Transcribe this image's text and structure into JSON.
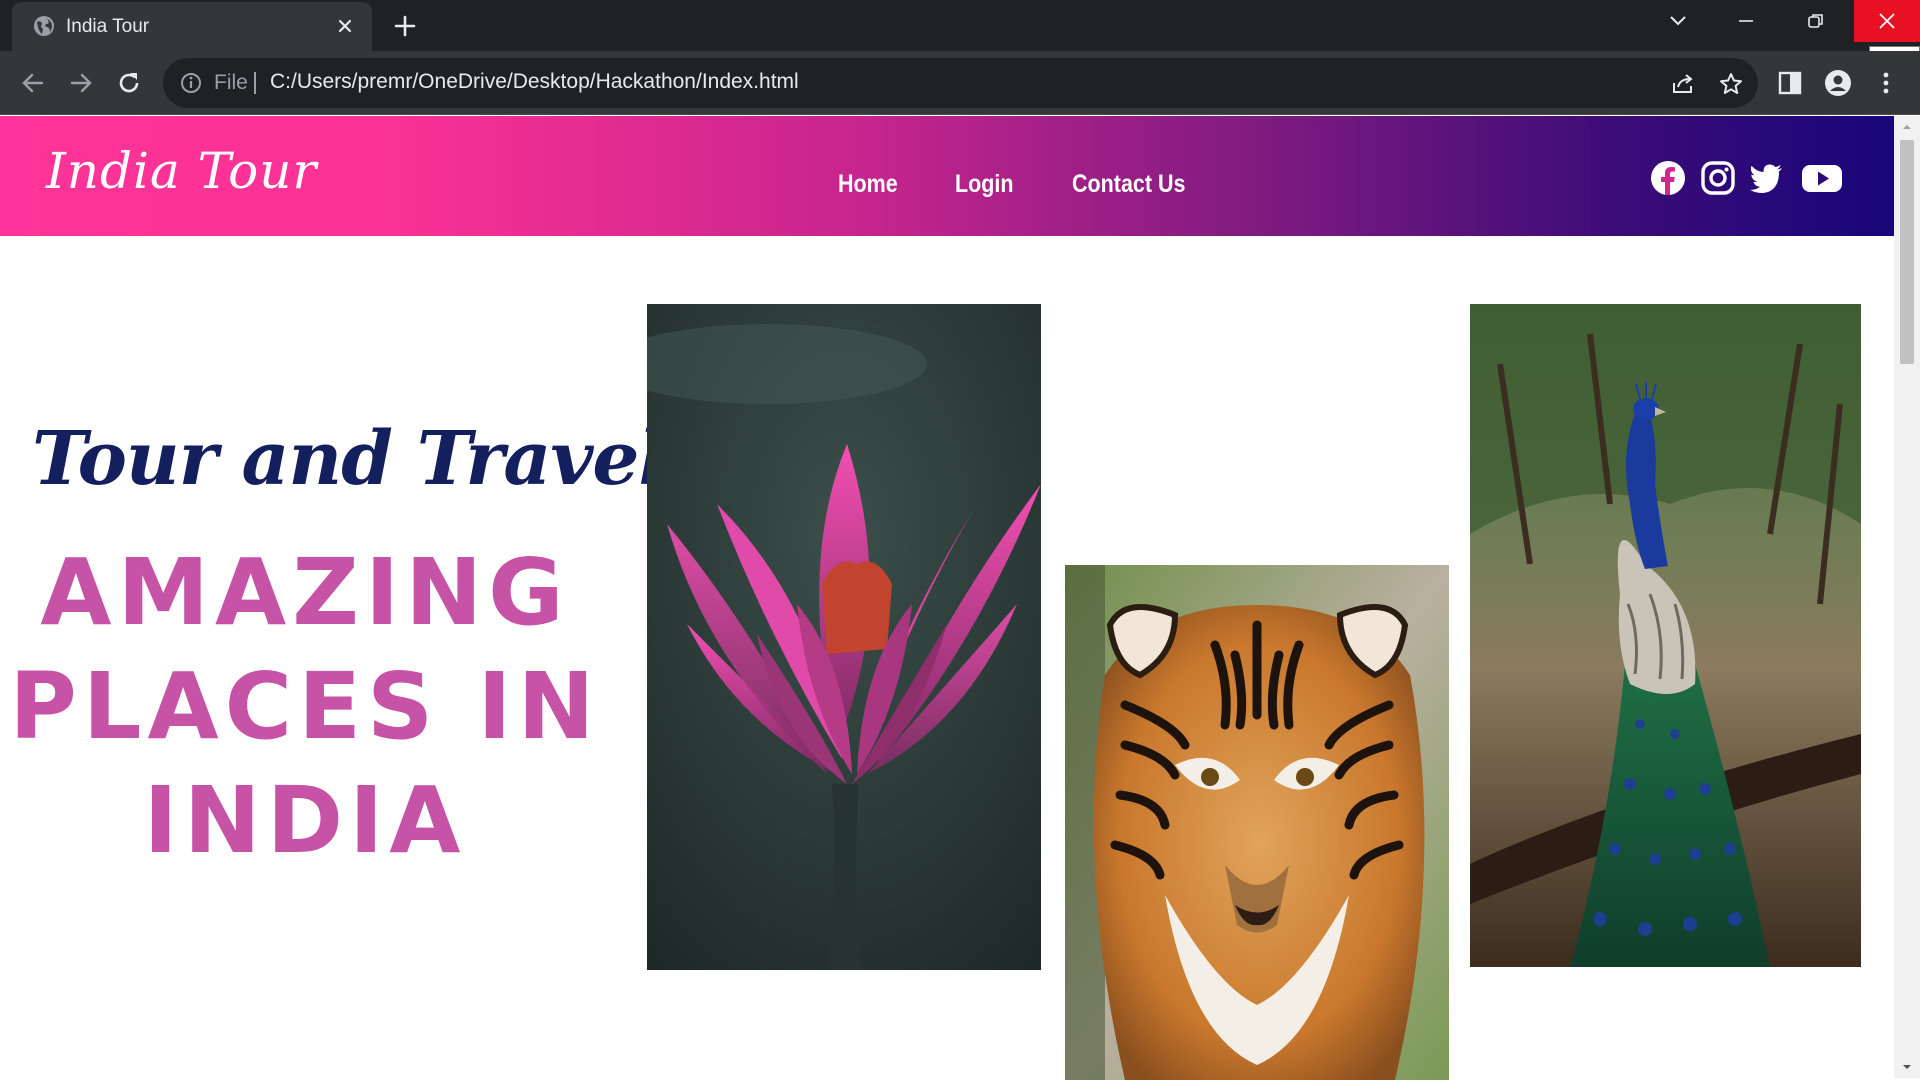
{
  "browser": {
    "tab_title": "India Tour",
    "omnibox_scheme_label": "File",
    "url": "C:/Users/premr/OneDrive/Desktop/Hackathon/Index.html",
    "close_tooltip": "Close"
  },
  "site": {
    "logo": "India Tour",
    "nav": [
      "Home",
      "Login",
      "Contact Us"
    ],
    "social_icons": [
      "facebook-icon",
      "instagram-icon",
      "twitter-icon",
      "youtube-icon"
    ],
    "header_gradient": [
      "#ff3399",
      "#c8258e",
      "#7a1a80",
      "#17067a"
    ]
  },
  "hero": {
    "tagline": "Tour and Travel",
    "headline_lines": [
      "AMAZING",
      "PLACES IN",
      "INDIA"
    ],
    "tagline_color": "#14205e",
    "headline_color": "#c753a6",
    "images": [
      "lotus-photo",
      "tiger-photo",
      "peacock-photo"
    ]
  }
}
